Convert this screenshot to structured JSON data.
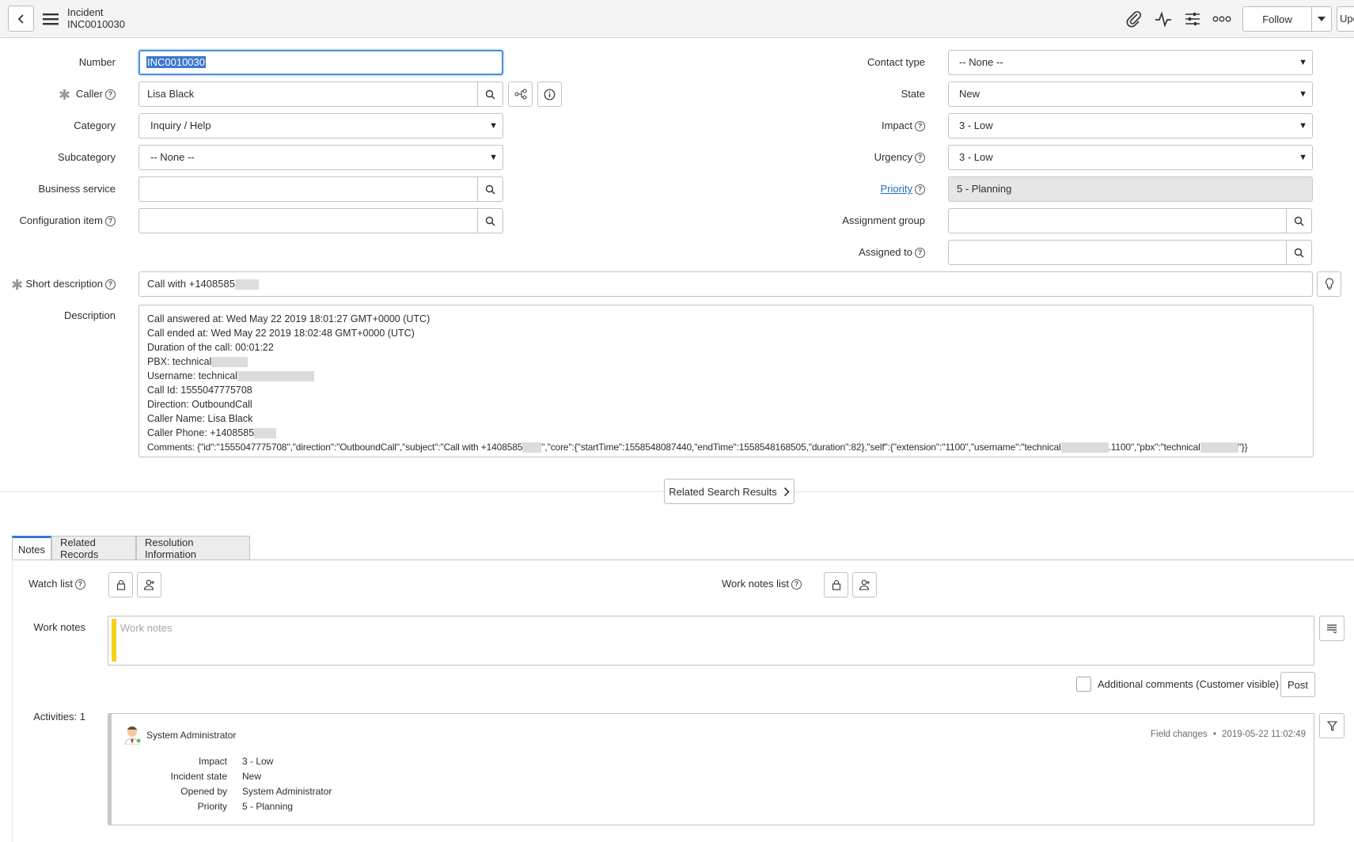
{
  "header": {
    "title": "Incident",
    "number": "INC0010030",
    "follow_label": "Follow",
    "update_label": "Update",
    "icons": [
      "paperclip-icon",
      "activity-icon",
      "sliders-icon",
      "more-icon"
    ]
  },
  "form": {
    "number": {
      "label": "Number",
      "value": "INC0010030"
    },
    "caller": {
      "label": "Caller",
      "value": "Lisa Black"
    },
    "category": {
      "label": "Category",
      "value": "Inquiry / Help"
    },
    "subcategory": {
      "label": "Subcategory",
      "value": "-- None --"
    },
    "business_service": {
      "label": "Business service",
      "value": ""
    },
    "configuration_item": {
      "label": "Configuration item",
      "value": ""
    },
    "contact_type": {
      "label": "Contact type",
      "value": "-- None --"
    },
    "state": {
      "label": "State",
      "value": "New"
    },
    "impact": {
      "label": "Impact",
      "value": "3 - Low"
    },
    "urgency": {
      "label": "Urgency",
      "value": "3 - Low"
    },
    "priority": {
      "label": "Priority",
      "value": "5 - Planning"
    },
    "assignment_group": {
      "label": "Assignment group",
      "value": ""
    },
    "assigned_to": {
      "label": "Assigned to",
      "value": ""
    },
    "short_description": {
      "label": "Short description",
      "value": "Call with +1408585"
    },
    "description": {
      "label": "Description",
      "lines": [
        "Call answered at: Wed May 22 2019 18:01:27 GMT+0000 (UTC)",
        "Call ended at: Wed May 22 2019 18:02:48 GMT+0000 (UTC)",
        "Duration of the call: 00:01:22",
        "PBX: technical",
        "Username: technical",
        "Call Id: 1555047775708",
        "Direction: OutboundCall",
        "Caller Name: Lisa Black",
        "Caller Phone: +1408585"
      ],
      "comments_parts": [
        "Comments: {\"id\":\"1555047775708\",\"direction\":\"OutboundCall\",\"subject\":\"Call with +1408585",
        "\",\"core\":{\"startTime\":1558548087440,\"endTime\":1558548168505,\"duration\":82},\"self\":{\"extension\":\"1100\",\"username\":\"technical",
        ".1100\",\"pbx\":\"technical",
        "\"}}"
      ]
    }
  },
  "related_search_label": "Related Search Results",
  "tabs": [
    {
      "label": "Notes",
      "active": true
    },
    {
      "label": "Related Records",
      "active": false
    },
    {
      "label": "Resolution Information",
      "active": false
    }
  ],
  "notes": {
    "watch_list_label": "Watch list",
    "work_notes_list_label": "Work notes list",
    "work_notes_label": "Work notes",
    "work_notes_placeholder": "Work notes",
    "additional_comments_label": "Additional comments (Customer visible)",
    "post_label": "Post",
    "activities_label": "Activities: 1"
  },
  "activity": {
    "author": "System Administrator",
    "type": "Field changes",
    "separator": "•",
    "timestamp": "2019-05-22 11:02:49",
    "fields": [
      {
        "key": "Impact",
        "value": "3 - Low"
      },
      {
        "key": "Incident state",
        "value": "New"
      },
      {
        "key": "Opened by",
        "value": "System Administrator"
      },
      {
        "key": "Priority",
        "value": "5 - Planning"
      }
    ]
  },
  "colors": {
    "accent": "#3b78cf",
    "work_notes_bar": "#f3d11d",
    "link": "#1f6fbf"
  }
}
